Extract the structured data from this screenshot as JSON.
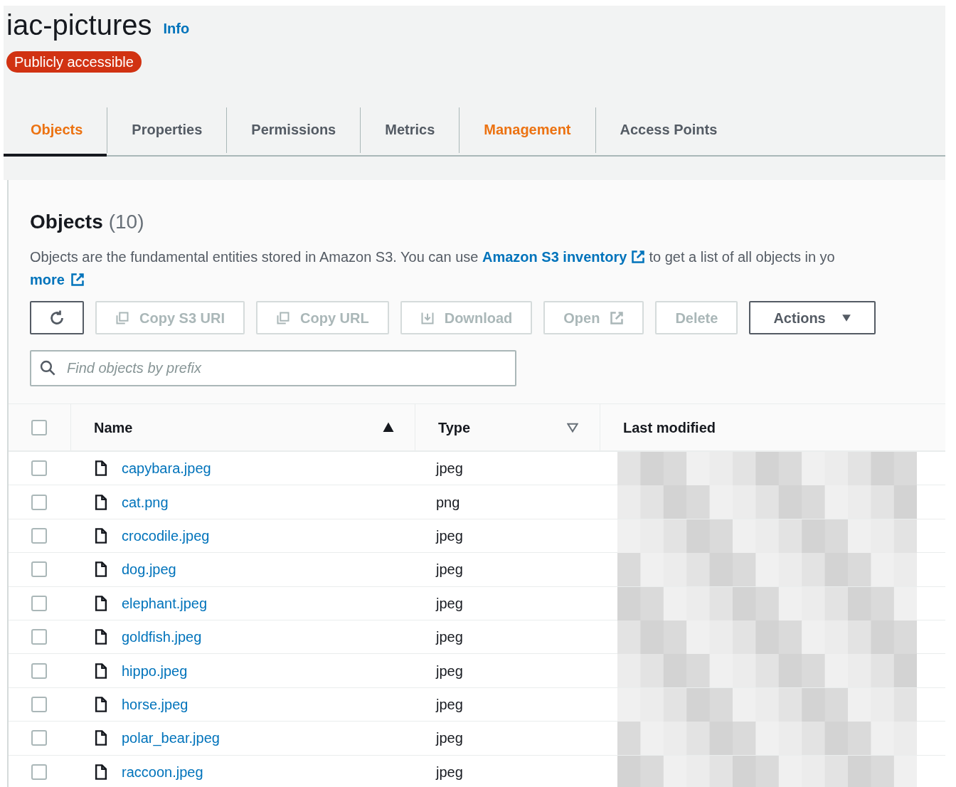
{
  "header": {
    "title": "iac-pictures",
    "info_link": "Info",
    "badge": "Publicly accessible"
  },
  "tabs": [
    {
      "label": "Objects",
      "selected": true,
      "highlighted": true
    },
    {
      "label": "Properties",
      "selected": false,
      "highlighted": false
    },
    {
      "label": "Permissions",
      "selected": false,
      "highlighted": false
    },
    {
      "label": "Metrics",
      "selected": false,
      "highlighted": false
    },
    {
      "label": "Management",
      "selected": false,
      "highlighted": true
    },
    {
      "label": "Access Points",
      "selected": false,
      "highlighted": false
    }
  ],
  "objects_panel": {
    "title": "Objects",
    "count": "(10)",
    "description": {
      "before": "Objects are the fundamental entities stored in Amazon S3. You can use",
      "link": "Amazon S3 inventory",
      "after": "to get a list of all objects in yo",
      "more_link": "more"
    },
    "buttons": [
      {
        "kind": "refresh",
        "disabled": false
      },
      {
        "kind": "copy",
        "label": "Copy S3 URI",
        "disabled": true
      },
      {
        "kind": "copy",
        "label": "Copy URL",
        "disabled": true
      },
      {
        "kind": "download",
        "label": "Download",
        "disabled": true
      },
      {
        "kind": "open",
        "label": "Open",
        "disabled": true
      },
      {
        "kind": "plain",
        "label": "Delete",
        "disabled": true
      },
      {
        "kind": "dropdown",
        "label": "Actions",
        "disabled": false
      }
    ],
    "search": {
      "placeholder": "Find objects by prefix"
    },
    "table": {
      "select_all_checked": false,
      "columns": [
        {
          "label": "Name",
          "sorted": true
        },
        {
          "label": "Type",
          "sorted": false
        },
        {
          "label": "Last modified"
        }
      ],
      "rows": [
        {
          "name": "capybara.jpeg",
          "type": "jpeg",
          "checked": false
        },
        {
          "name": "cat.png",
          "type": "png",
          "checked": false
        },
        {
          "name": "crocodile.jpeg",
          "type": "jpeg",
          "checked": false
        },
        {
          "name": "dog.jpeg",
          "type": "jpeg",
          "checked": false
        },
        {
          "name": "elephant.jpeg",
          "type": "jpeg",
          "checked": false
        },
        {
          "name": "goldfish.jpeg",
          "type": "jpeg",
          "checked": false
        },
        {
          "name": "hippo.jpeg",
          "type": "jpeg",
          "checked": false
        },
        {
          "name": "horse.jpeg",
          "type": "jpeg",
          "checked": false
        },
        {
          "name": "polar_bear.jpeg",
          "type": "jpeg",
          "checked": false
        },
        {
          "name": "raccoon.jpeg",
          "type": "jpeg",
          "checked": false
        }
      ]
    }
  }
}
